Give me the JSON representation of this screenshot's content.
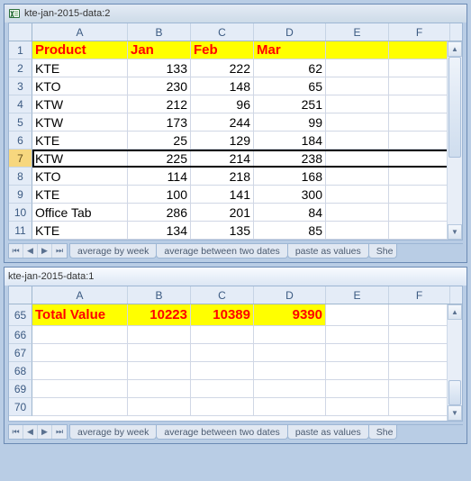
{
  "window1": {
    "title": "kte-jan-2015-data:2",
    "columns": [
      "A",
      "B",
      "C",
      "D",
      "E",
      "F"
    ],
    "row_numbers": [
      1,
      2,
      3,
      4,
      5,
      6,
      7,
      8,
      9,
      10,
      11
    ],
    "selected_row": 7,
    "header_row": {
      "product": "Product",
      "jan": "Jan",
      "feb": "Feb",
      "mar": "Mar"
    },
    "rows": [
      {
        "p": "KTE",
        "j": 133,
        "f": 222,
        "m": 62
      },
      {
        "p": "KTO",
        "j": 230,
        "f": 148,
        "m": 65
      },
      {
        "p": "KTW",
        "j": 212,
        "f": 96,
        "m": 251
      },
      {
        "p": "KTW",
        "j": 173,
        "f": 244,
        "m": 99
      },
      {
        "p": "KTE",
        "j": 25,
        "f": 129,
        "m": 184
      },
      {
        "p": "KTW",
        "j": 225,
        "f": 214,
        "m": 238
      },
      {
        "p": "KTO",
        "j": 114,
        "f": 218,
        "m": 168
      },
      {
        "p": "KTE",
        "j": 100,
        "f": 141,
        "m": 300
      },
      {
        "p": "Office Tab",
        "j": 286,
        "f": 201,
        "m": 84
      },
      {
        "p": "KTE",
        "j": 134,
        "f": 135,
        "m": 85
      }
    ],
    "tabs": [
      "average by week",
      "average between two dates",
      "paste as values",
      "She"
    ]
  },
  "window2": {
    "title": "kte-jan-2015-data:1",
    "columns": [
      "A",
      "B",
      "C",
      "D",
      "E",
      "F"
    ],
    "row_numbers": [
      65,
      66,
      67,
      68,
      69,
      70
    ],
    "totals": {
      "label": "Total Value",
      "jan": 10223,
      "feb": 10389,
      "mar": 9390
    },
    "tabs": [
      "average by week",
      "average between two dates",
      "paste as values",
      "She"
    ]
  },
  "nav_glyphs": {
    "first": "⏮",
    "prev": "◀",
    "next": "▶",
    "last": "⏭"
  }
}
